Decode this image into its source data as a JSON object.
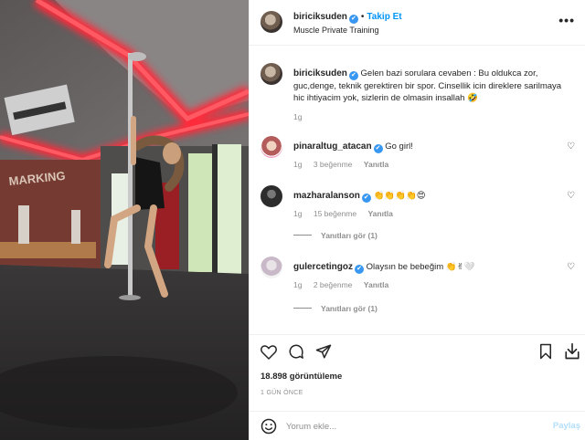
{
  "header": {
    "username": "biriciksuden",
    "verified_mark": "✔",
    "separator": "•",
    "follow_label": "Takip Et",
    "location": "Muscle Private Training",
    "more_icon": "more-horizontal-icon"
  },
  "photo": {
    "description_icon": "post-photo",
    "sign_text": "MARKING"
  },
  "caption": {
    "username": "biriciksuden",
    "text": "Gelen bazi sorulara cevaben : Bu oldukca zor, guc,denge, teknik gerektiren bir spor. Cinsellik icin direklere sarilmaya hic ihtiyacim yok, sizlerin de olmasin insallah 🤣",
    "time": "1g"
  },
  "comments": [
    {
      "username": "pinaraltug_atacan",
      "text": "Go girl!",
      "time": "1g",
      "likes": "3 beğenme",
      "reply_label": "Yanıtla",
      "replies_label": ""
    },
    {
      "username": "mazharalanson",
      "text": "👏👏👏👏😍",
      "time": "1g",
      "likes": "15 beğenme",
      "reply_label": "Yanıtla",
      "replies_label": "Yanıtları gör (1)"
    },
    {
      "username": "gulercetingoz",
      "text": "Olaysın be bebeğim 👏✌🤍",
      "time": "1g",
      "likes": "2 beğenme",
      "reply_label": "Yanıtla",
      "replies_label": "Yanıtları gör (1)"
    }
  ],
  "actions": {
    "like_icon": "heart-icon",
    "comment_icon": "comment-icon",
    "share_icon": "send-icon",
    "save_icon": "bookmark-icon",
    "download_icon": "download-icon"
  },
  "stats": {
    "views": "18.898 görüntüleme",
    "posted": "1 GÜN ÖNCE"
  },
  "add_comment": {
    "placeholder": "Yorum ekle...",
    "post_label": "Paylaş",
    "emoji_icon": "smiley-icon"
  },
  "colors": {
    "accent": "#0095f6",
    "verified": "#3897f0",
    "neon": "#ff2a3a"
  }
}
